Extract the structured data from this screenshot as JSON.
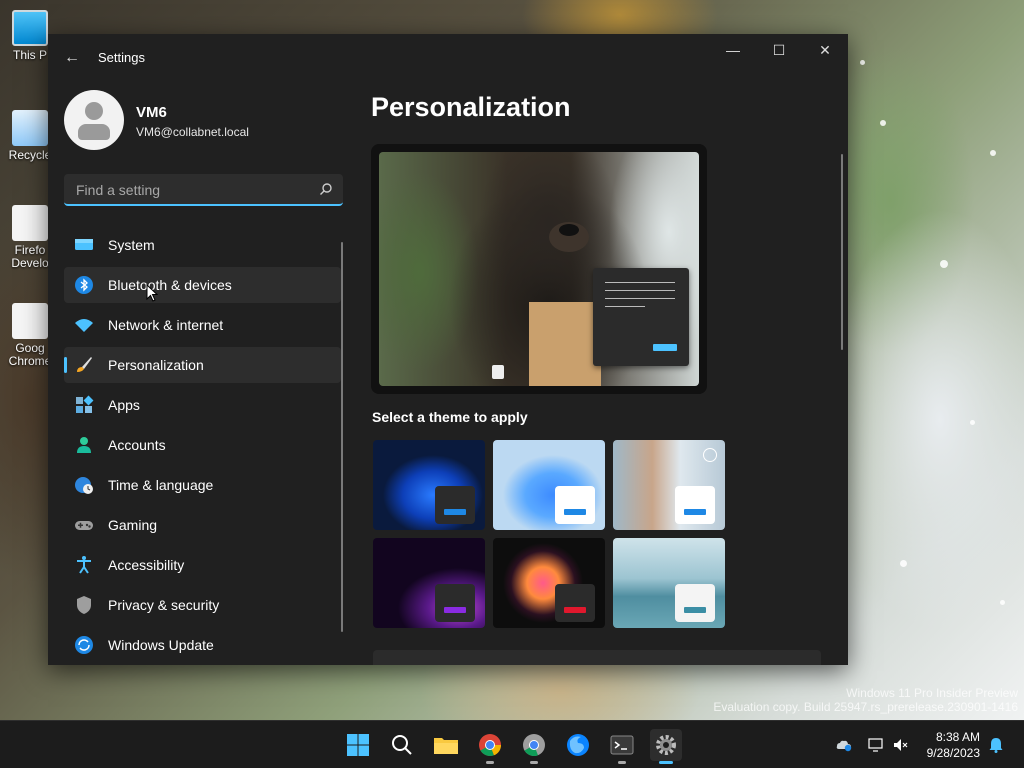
{
  "desktop": {
    "icons": [
      {
        "label": "This P",
        "icon": "computer-icon"
      },
      {
        "label": "Recycle",
        "icon": "recycle-bin-icon"
      },
      {
        "label": "Firefo Develo",
        "icon": "firefox-developer-shortcut-icon"
      },
      {
        "label": "Goog Chrome",
        "icon": "chrome-shortcut-icon"
      }
    ],
    "watermark": {
      "line1": "Windows 11 Pro Insider Preview",
      "line2": "Evaluation copy. Build 25947.rs_prerelease.230901-1416"
    }
  },
  "window": {
    "title": "Settings",
    "controls": {
      "minimize": "—",
      "maximize": "☐",
      "close": "✕"
    },
    "back": "←"
  },
  "user": {
    "name": "VM6",
    "email": "VM6@collabnet.local"
  },
  "search": {
    "placeholder": "Find a setting"
  },
  "nav": {
    "items": [
      {
        "label": "System",
        "icon": "system-icon"
      },
      {
        "label": "Bluetooth & devices",
        "icon": "bluetooth-icon"
      },
      {
        "label": "Network & internet",
        "icon": "wifi-icon"
      },
      {
        "label": "Personalization",
        "icon": "brush-icon"
      },
      {
        "label": "Apps",
        "icon": "apps-icon"
      },
      {
        "label": "Accounts",
        "icon": "accounts-icon"
      },
      {
        "label": "Time & language",
        "icon": "globe-clock-icon"
      },
      {
        "label": "Gaming",
        "icon": "gamepad-icon"
      },
      {
        "label": "Accessibility",
        "icon": "accessibility-icon"
      },
      {
        "label": "Privacy & security",
        "icon": "shield-icon"
      },
      {
        "label": "Windows Update",
        "icon": "update-icon"
      }
    ],
    "active": "Personalization",
    "hovered": "Bluetooth & devices"
  },
  "main": {
    "title": "Personalization",
    "theme_heading": "Select a theme to apply",
    "themes": [
      {
        "name": "windows-dark-bloom",
        "selected": false
      },
      {
        "name": "windows-light-bloom",
        "selected": false
      },
      {
        "name": "custom-photo",
        "selected": true
      },
      {
        "name": "glow",
        "selected": false
      },
      {
        "name": "captured-motion",
        "selected": false
      },
      {
        "name": "flow",
        "selected": false
      }
    ]
  },
  "taskbar": {
    "apps": [
      "start-icon",
      "search-icon",
      "file-explorer-icon",
      "chrome-icon",
      "chrome-dev-icon",
      "firefox-dev-icon",
      "terminal-icon",
      "settings-icon"
    ],
    "active_app": "settings-icon",
    "time": "8:38 AM",
    "date": "9/28/2023"
  },
  "colors": {
    "accent": "#4cc2ff",
    "window_bg": "#202020",
    "item_bg": "#2d2d2d"
  }
}
